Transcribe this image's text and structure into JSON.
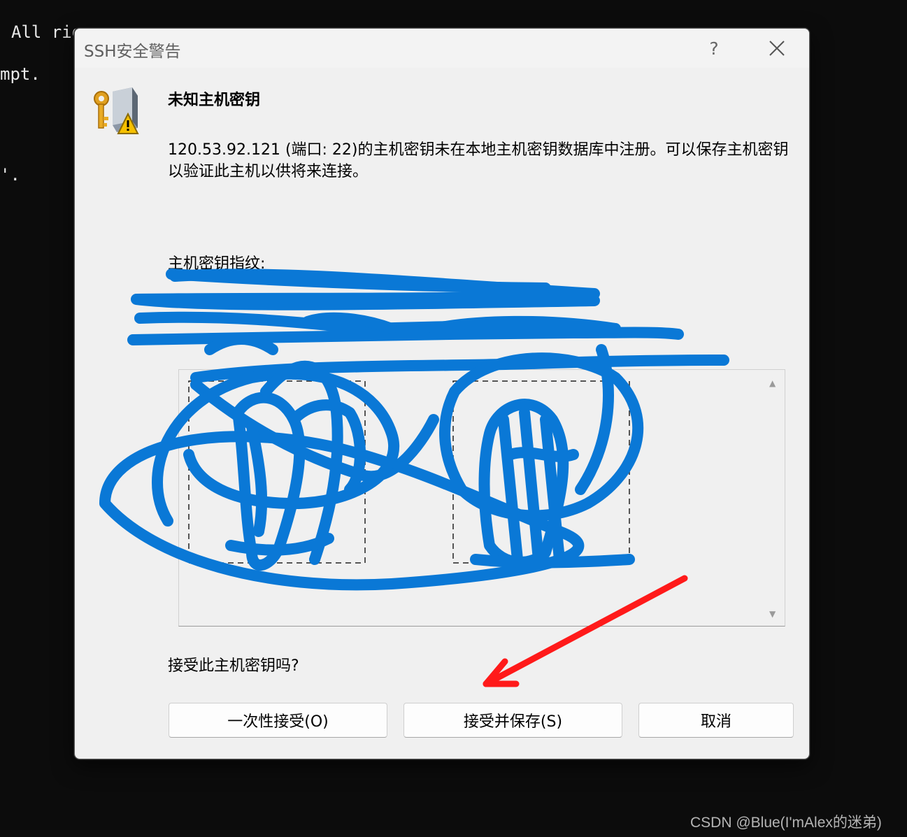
{
  "terminal": {
    "lines": [
      "All rig",
      "mpt.",
      "'."
    ]
  },
  "dialog": {
    "title": "SSH安全警告",
    "help_label": "?",
    "heading": "未知主机密钥",
    "message": "120.53.92.121 (端口: 22)的主机密钥未在本地主机密钥数据库中注册。可以保存主机密钥以验证此主机以供将来连接。",
    "fingerprint_label": "主机密钥指纹:",
    "question": "接受此主机密钥吗?",
    "buttons": {
      "accept_once": "一次性接受(O)",
      "accept_save": "接受并保存(S)",
      "cancel": "取消"
    },
    "icons": {
      "app": "key-warning-icon",
      "close": "close-icon",
      "scroll_up": "scroll-up-icon",
      "scroll_down": "scroll-down-icon"
    }
  },
  "watermark": "CSDN @Blue(I'mAlex的迷弟)",
  "colors": {
    "scribble": "#0a78d6",
    "arrow": "#ff1a1a",
    "terminal_bg": "#0c0c0c",
    "dialog_bg": "#f0f0f0"
  }
}
